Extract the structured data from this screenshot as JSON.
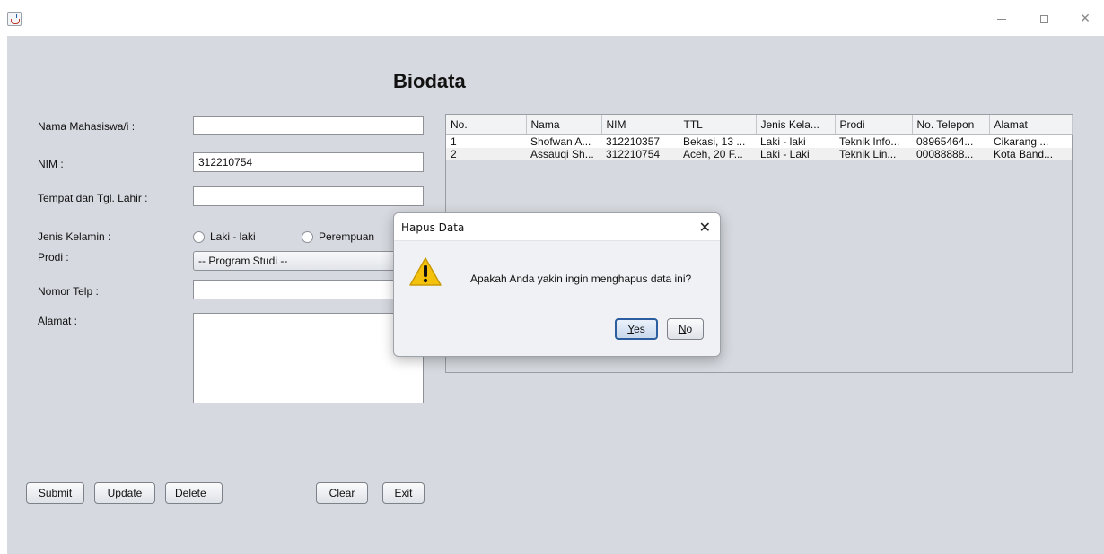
{
  "window": {
    "minimize_icon": "minimize-icon",
    "maximize_icon": "maximize-icon",
    "close_glyph": "✕"
  },
  "page_title": "Biodata",
  "form": {
    "nama_label": "Nama Mahasiswa/i :",
    "nama_value": "",
    "nim_label": "NIM :",
    "nim_value": "312210754",
    "ttl_label": "Tempat dan Tgl. Lahir :",
    "ttl_value": "",
    "jk_label": "Jenis Kelamin :",
    "jk_option_1": "Laki - laki",
    "jk_option_2": "Perempuan",
    "prodi_label": "Prodi :",
    "prodi_selected": "-- Program Studi --",
    "telp_label": "Nomor Telp :",
    "telp_value": "",
    "alamat_label": "Alamat :",
    "alamat_value": ""
  },
  "buttons": {
    "submit": "Submit",
    "update": "Update",
    "delete": "Delete",
    "clear": "Clear",
    "exit": "Exit"
  },
  "table": {
    "headers": [
      "No.",
      "Nama",
      "NIM",
      "TTL",
      "Jenis Kela...",
      "Prodi",
      "No. Telepon",
      "Alamat"
    ],
    "rows": [
      [
        "1",
        "Shofwan A...",
        "312210357",
        "Bekasi, 13 ...",
        "Laki - laki",
        "Teknik Info...",
        "08965464...",
        "Cikarang ..."
      ],
      [
        "2",
        "Assauqi Sh...",
        "312210754",
        "Aceh, 20 F...",
        "Laki - Laki",
        "Teknik Lin...",
        "00088888...",
        "Kota Band..."
      ]
    ]
  },
  "dialog": {
    "title": "Hapus Data",
    "close_glyph": "✕",
    "message": "Apakah Anda yakin ingin menghapus data ini?",
    "yes_label": "Yes",
    "no_label": "No",
    "icon": "warning-icon"
  }
}
